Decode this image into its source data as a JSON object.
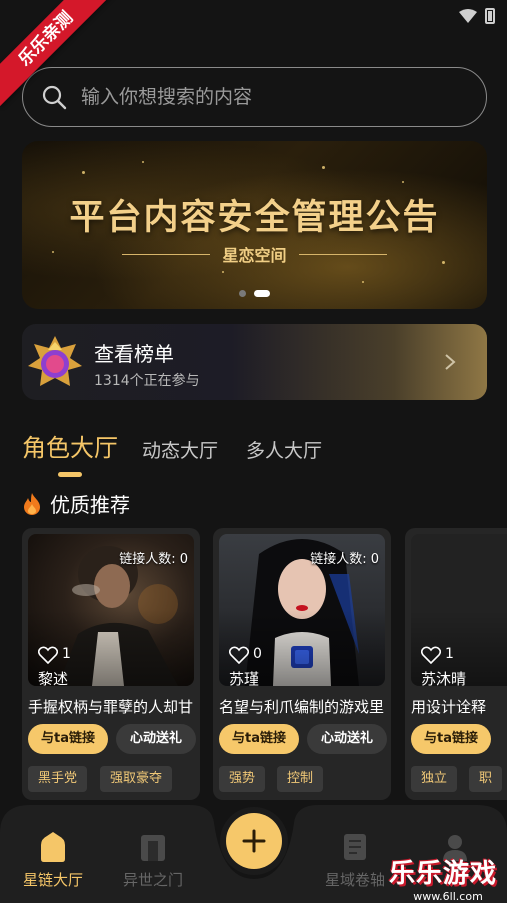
{
  "ribbon": {
    "label": "乐乐亲测"
  },
  "search": {
    "placeholder": "输入你想搜索的内容"
  },
  "banner": {
    "title": "平台内容安全管理公告",
    "subtitle": "星恋空间",
    "slide_count": 2,
    "active_slide": 2
  },
  "ranking": {
    "title": "查看榜单",
    "participants": "1314个正在参与"
  },
  "tabs": [
    {
      "label": "角色大厅",
      "active": true
    },
    {
      "label": "动态大厅",
      "active": false
    },
    {
      "label": "多人大厅",
      "active": false
    }
  ],
  "section": {
    "title": "优质推荐"
  },
  "cards": [
    {
      "link_count": "链接人数: 0",
      "likes": "1",
      "name": "黎述",
      "description": "手握权柄与罪孽的人却甘",
      "link_button": "与ta链接",
      "gift_button": "心动送礼",
      "tags": [
        "黑手党",
        "强取豪夺"
      ]
    },
    {
      "link_count": "链接人数: 0",
      "likes": "0",
      "name": "苏瑾",
      "description": "名望与利爪编制的游戏里",
      "link_button": "与ta链接",
      "gift_button": "心动送礼",
      "tags": [
        "强势",
        "控制"
      ]
    },
    {
      "link_count": "",
      "likes": "1",
      "name": "苏沐晴",
      "description": "用设计诠释",
      "link_button": "与ta链接",
      "gift_button": "",
      "tags": [
        "独立",
        "职"
      ]
    }
  ],
  "bottom_nav": {
    "items": [
      {
        "label": "星链大厅",
        "active": true
      },
      {
        "label": "异世之门",
        "active": false
      },
      {
        "label": "星域卷轴",
        "active": false
      },
      {
        "label": "",
        "active": false
      }
    ]
  },
  "watermark": {
    "title": "乐乐游戏",
    "url": "www.6ll.com"
  },
  "colors": {
    "accent": "#f5c668",
    "background": "#141414",
    "card": "#262626"
  }
}
